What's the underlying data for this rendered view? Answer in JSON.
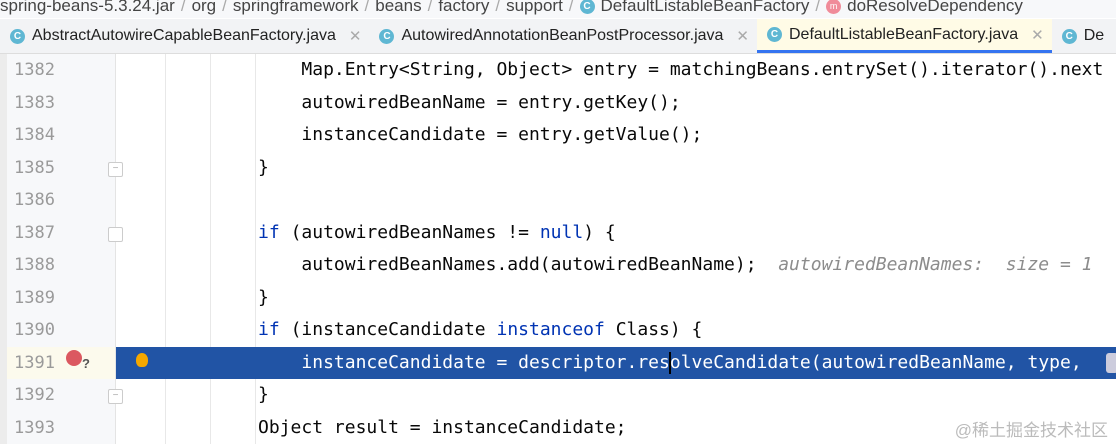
{
  "breadcrumb": [
    "spring-beans-5.3.24.jar",
    "org",
    "springframework",
    "beans",
    "factory",
    "support",
    "DefaultListableBeanFactory",
    "doResolveDependency"
  ],
  "tabs": [
    {
      "label": "AbstractAutowireCapableBeanFactory.java",
      "icon": "class-icon",
      "active": false
    },
    {
      "label": "AutowiredAnnotationBeanPostProcessor.java",
      "icon": "class-icon",
      "active": false
    },
    {
      "label": "DefaultListableBeanFactory.java",
      "icon": "class-icon",
      "active": true
    },
    {
      "label": "De",
      "icon": "class-icon",
      "active": false
    }
  ],
  "lines": [
    {
      "n": "1382",
      "tokens": [
        {
          "t": "    Map.Entry<String, Object> entry = matchingBeans.entrySet().iterator().next"
        }
      ]
    },
    {
      "n": "1383",
      "tokens": [
        {
          "t": "    autowiredBeanName = entry.getKey();"
        }
      ]
    },
    {
      "n": "1384",
      "tokens": [
        {
          "t": "    instanceCandidate = entry.getValue();"
        }
      ]
    },
    {
      "n": "1385",
      "tokens": [
        {
          "t": "}"
        }
      ]
    },
    {
      "n": "1386",
      "tokens": []
    },
    {
      "n": "1387",
      "tokens": [
        {
          "t": "if",
          "k": "kw"
        },
        {
          "t": " (autowiredBeanNames != "
        },
        {
          "t": "null",
          "k": "kw"
        },
        {
          "t": ") {"
        }
      ]
    },
    {
      "n": "1388",
      "tokens": [
        {
          "t": "    autowiredBeanNames.add(autowiredBeanName);  "
        },
        {
          "t": "autowiredBeanNames:  size = 1",
          "k": "hint"
        }
      ]
    },
    {
      "n": "1389",
      "tokens": [
        {
          "t": "}"
        }
      ]
    },
    {
      "n": "1390",
      "tokens": [
        {
          "t": "if",
          "k": "kw"
        },
        {
          "t": " (instanceCandidate "
        },
        {
          "t": "instanceof",
          "k": "kw"
        },
        {
          "t": " Class) {"
        }
      ]
    },
    {
      "n": "1391",
      "tokens": [
        {
          "t": "    instanceCandidate = descriptor.res"
        },
        {
          "t": "",
          "k": "caret"
        },
        {
          "t": "olveCandidate(autowiredBeanName, type, "
        }
      ],
      "selected": true
    },
    {
      "n": "1392",
      "tokens": [
        {
          "t": "}"
        }
      ]
    },
    {
      "n": "1393",
      "tokens": [
        {
          "t": "Object result = instanceCandidate;"
        }
      ]
    }
  ],
  "watermark": "@稀土掘金技术社区",
  "colors": {
    "selection": "#2154a5",
    "keyword": "#0033b3"
  }
}
